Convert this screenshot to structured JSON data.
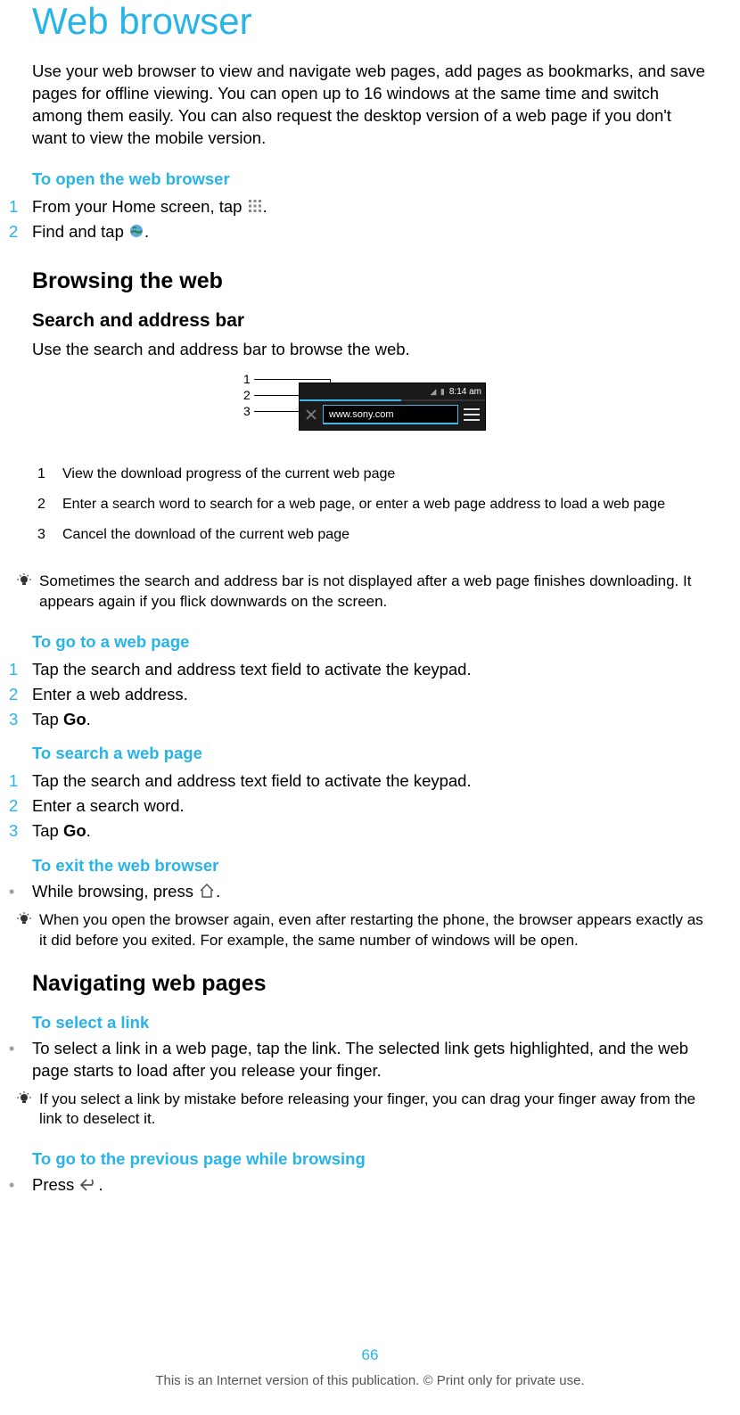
{
  "title": "Web browser",
  "intro": "Use your web browser to view and navigate web pages, add pages as bookmarks, and save pages for offline viewing. You can open up to 16 windows at the same time and switch among them easily. You can also request the desktop version of a web page if you don't want to view the mobile version.",
  "open_browser": {
    "heading": "To open the web browser",
    "steps": {
      "s1_num": "1",
      "s1_a": "From your Home screen, tap ",
      "s1_b": ".",
      "s2_num": "2",
      "s2_a": "Find and tap ",
      "s2_b": "."
    }
  },
  "browsing": {
    "heading": "Browsing the web",
    "search_bar": {
      "heading": "Search and address bar",
      "text": "Use the search and address bar to browse the web."
    }
  },
  "diagram": {
    "url": "www.sony.com",
    "time": "8:14 am",
    "callouts": {
      "c1": "1",
      "c2": "2",
      "c3": "3"
    }
  },
  "legend": {
    "r1n": "1",
    "r1d": "View the download progress of the current web page",
    "r2n": "2",
    "r2d": "Enter a search word to search for a web page, or enter a web page address to load a web page",
    "r3n": "3",
    "r3d": "Cancel the download of the current web page"
  },
  "tip1": "Sometimes the search and address bar is not displayed after a web page finishes downloading. It appears again if you flick downwards on the screen.",
  "goto_page": {
    "heading": "To go to a web page",
    "s1n": "1",
    "s1": "Tap the search and address text field to activate the keypad.",
    "s2n": "2",
    "s2": "Enter a web address.",
    "s3n": "3",
    "s3a": "Tap ",
    "s3b": "Go",
    "s3c": "."
  },
  "search_page": {
    "heading": "To search a web page",
    "s1n": "1",
    "s1": "Tap the search and address text field to activate the keypad.",
    "s2n": "2",
    "s2": "Enter a search word.",
    "s3n": "3",
    "s3a": "Tap ",
    "s3b": "Go",
    "s3c": "."
  },
  "exit": {
    "heading": "To exit the web browser",
    "step_a": "While browsing, press ",
    "step_b": "."
  },
  "tip2": "When you open the browser again, even after restarting the phone, the browser appears exactly as it did before you exited. For example, the same number of windows will be open.",
  "nav": {
    "heading": "Navigating web pages",
    "select_link": {
      "heading": "To select a link",
      "text": "To select a link in a web page, tap the link. The selected link gets highlighted, and the web page starts to load after you release your finger."
    },
    "tip": "If you select a link by mistake before releasing your finger, you can drag your finger away from the link to deselect it.",
    "prev_page": {
      "heading": "To go to the previous page while browsing",
      "step_a": "Press ",
      "step_b": "."
    }
  },
  "footer": {
    "page": "66",
    "notice": "This is an Internet version of this publication. © Print only for private use."
  }
}
